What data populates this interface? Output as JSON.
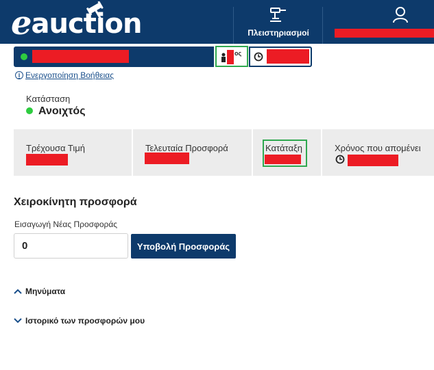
{
  "header": {
    "logo_e": "e",
    "logo_word": "auction",
    "nav_auctions_label": "Πλειστηριασμοί",
    "brand_color": "#0d3a6b"
  },
  "auction_bar": {
    "rank_suffix": "ος"
  },
  "help": {
    "label": "Ενεργοποίηση Βοήθειας"
  },
  "status": {
    "label": "Κατάσταση",
    "value": "Ανοιχτός",
    "indicator_color": "#2ecc40"
  },
  "stats": {
    "current_price_label": "Τρέχουσα Τιμή",
    "last_bid_label": "Τελευταία Προσφορά",
    "ranking_label": "Κατάταξη",
    "time_left_label": "Χρόνος που απομένει"
  },
  "manual_bid": {
    "title": "Χειροκίνητη προσφορά",
    "input_label": "Εισαγωγή Νέας Προσφοράς",
    "input_value": "0",
    "submit_label": "Υποβολή Προσφοράς"
  },
  "sections": {
    "messages_label": "Μηνύματα",
    "history_label": "Ιστορικό των προσφορών μου"
  },
  "icons": [
    "gavel-icon",
    "user-icon",
    "person-icon",
    "clock-icon",
    "info-icon",
    "chevron-up-icon",
    "chevron-down-icon"
  ]
}
